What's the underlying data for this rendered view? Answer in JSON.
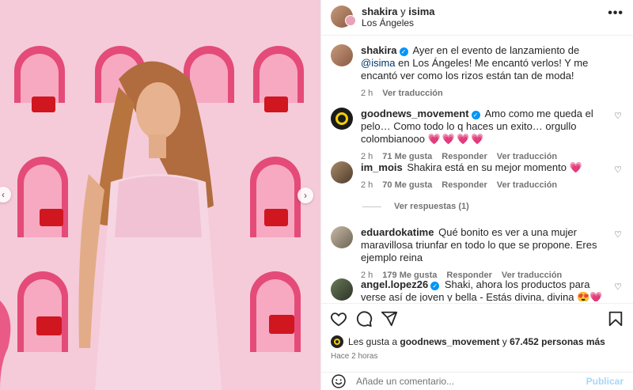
{
  "post": {
    "author": "shakira",
    "collab_sep": "y",
    "collaborator": "isima",
    "location": "Los Ángeles"
  },
  "caption": {
    "username": "shakira",
    "text_before": " Ayer en el evento de lanzamiento de ",
    "mention": "@isima",
    "text_after": " en Los Ángeles! Me encantó verlos! Y me encantó ver como los rizos están tan de moda!",
    "age": "2 h",
    "translate": "Ver traducción"
  },
  "comments": [
    {
      "username": "goodnews_movement",
      "verified": true,
      "text": "Amo como me queda el pelo… Como todo lo q haces un exito… orgullo colombianooo",
      "emoji": "💗💗💗💗",
      "age": "2 h",
      "likes": "71 Me gusta",
      "reply": "Responder",
      "translate": "Ver traducción"
    },
    {
      "username": "im_mois",
      "verified": false,
      "text": "Shakira está en su mejor momento",
      "emoji": "💗",
      "age": "2 h",
      "likes": "70 Me gusta",
      "reply": "Responder",
      "translate": "Ver traducción",
      "view_replies": "Ver respuestas (1)"
    },
    {
      "username": "eduardokatime",
      "verified": false,
      "text": "Qué bonito es ver a una mujer maravillosa triunfar en todo lo que se propone. Eres ejemplo reina",
      "emoji": "",
      "age": "2 h",
      "likes": "179 Me gusta",
      "reply": "Responder",
      "translate": "Ver traducción"
    },
    {
      "username": "angel.lopez26",
      "verified": true,
      "text": "Shaki, ahora los productos para verse así de joven y bella - Estás divina, divina",
      "emoji": "😍💗🔥",
      "age": "2 h",
      "likes": "",
      "reply": "",
      "translate": ""
    }
  ],
  "likes": {
    "prefix": "Les gusta a",
    "user": "goodnews_movement",
    "conj": "y",
    "count": "67.452 personas más"
  },
  "timestamp": "Hace 2 horas",
  "compose": {
    "placeholder": "Añade un comentario...",
    "publish": "Publicar"
  },
  "icons": [
    "more-icon",
    "verified-icon",
    "heart-icon",
    "comment-icon",
    "share-icon",
    "save-icon",
    "emoji-icon",
    "chevron-left-icon",
    "chevron-right-icon"
  ],
  "colors": {
    "accent": "#0095f6",
    "link": "#00376b",
    "heart": "#e0245e",
    "publish_disabled": "#a7d7f9",
    "wall": "#f3c4d3"
  }
}
